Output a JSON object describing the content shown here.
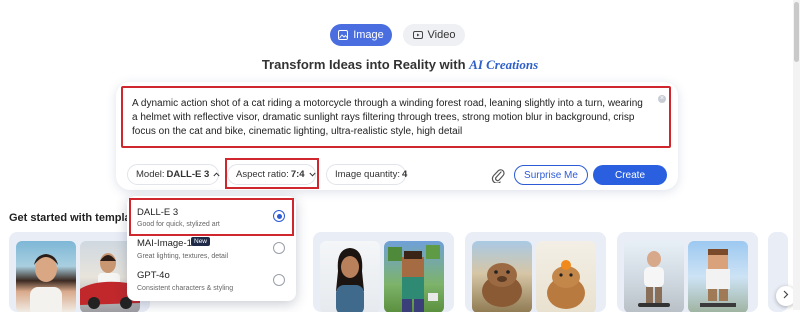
{
  "tabs": [
    {
      "label": "Image",
      "icon": "image-icon",
      "active": true
    },
    {
      "label": "Video",
      "icon": "video-icon",
      "active": false
    }
  ],
  "title": {
    "text": "Transform Ideas into Reality with ",
    "brand": "AI Creations"
  },
  "prompt": {
    "value": "A dynamic action shot of a cat riding a motorcycle through a winding forest road, leaning slightly into a turn, wearing a helmet with reflective visor, dramatic sunlight rays filtering through trees, strong motion blur in background, crisp focus on the cat and bike, cinematic lighting, ultra-realistic style, high detail"
  },
  "toolbar": {
    "model_label": "Model:",
    "model_value": "DALL-E 3",
    "aspect_label": "Aspect ratio:",
    "aspect_value": "7:4",
    "quantity_label": "Image quantity:",
    "quantity_value": "4",
    "surprise_label": "Surprise Me",
    "create_label": "Create"
  },
  "templates": {
    "heading": "Get started with templates"
  },
  "model_dropdown": {
    "options": [
      {
        "name": "DALL-E 3",
        "desc": "Good for quick, stylized art",
        "selected": true
      },
      {
        "name": "MAI-Image-1",
        "badge": "New",
        "desc": "Great lighting, textures, detail",
        "selected": false
      },
      {
        "name": "GPT-4o",
        "desc": "Consistent characters & styling",
        "selected": false
      }
    ]
  },
  "colors": {
    "accent": "#2a5fe0",
    "highlight_outline": "#d0262e",
    "card_bg": "#e9edf6"
  }
}
